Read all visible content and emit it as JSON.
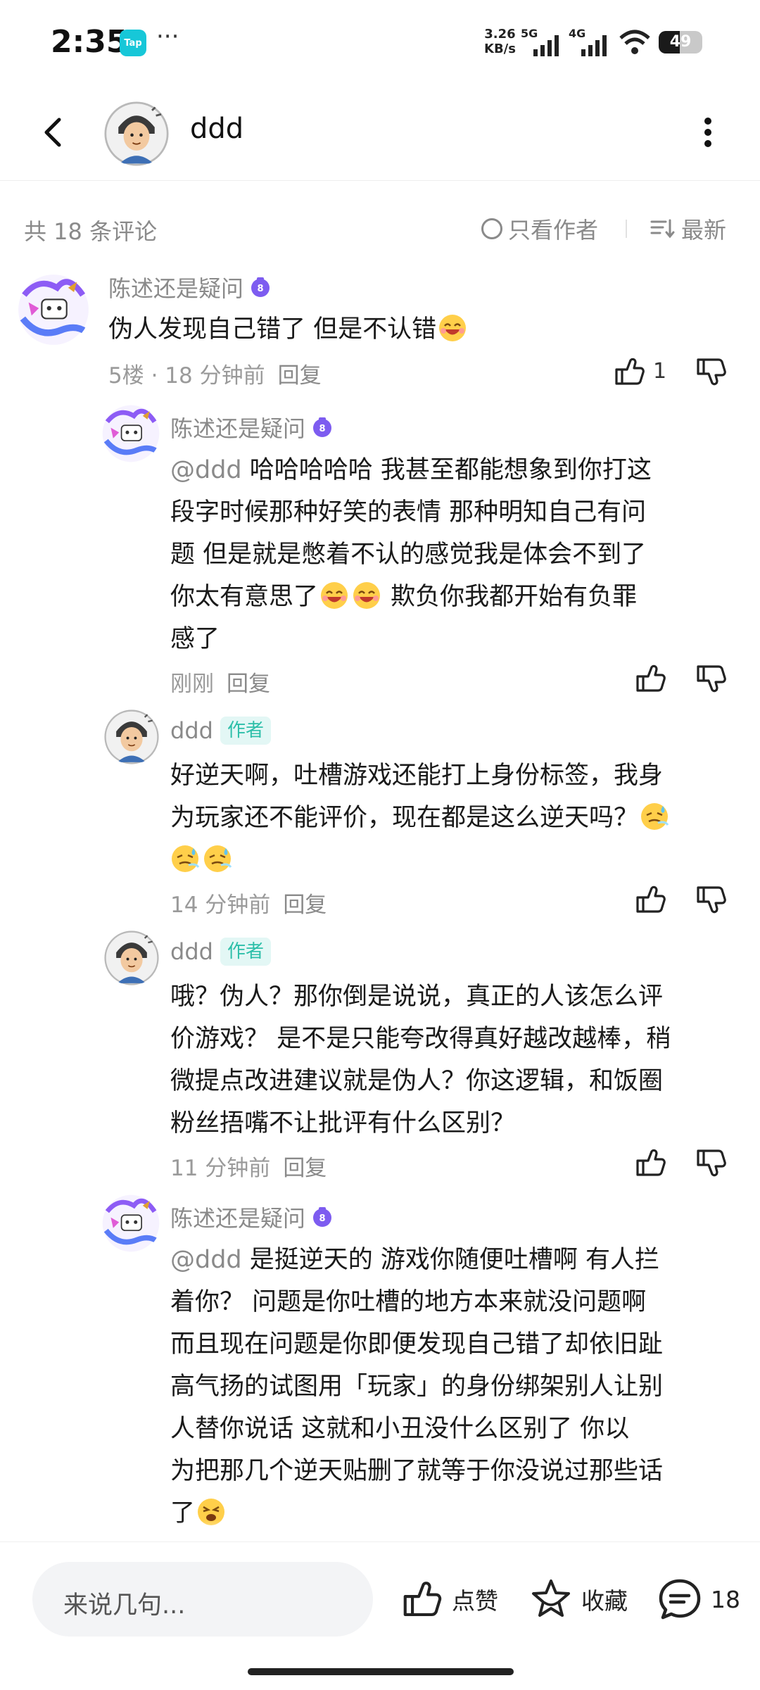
{
  "status_bar": {
    "time": "2:35",
    "app_badge": "Tap",
    "more_dots": "···",
    "speed_value": "3.26",
    "speed_unit": "KB/s",
    "net1": "5G",
    "net2": "4G",
    "battery": "49",
    "battery_fraction": 0.49
  },
  "header": {
    "title": "ddd",
    "back_icon": "chevron-left-icon",
    "more_icon": "vertical-dots-icon"
  },
  "filter": {
    "count": "共 18 条评论",
    "only_author": "只看作者",
    "sort": "最新"
  },
  "colors": {
    "author_tag_bg": "#e3f7f5",
    "author_tag_fg": "#2dbfa9",
    "meta_gray": "#9a9a9a",
    "tap_cyan": "#17c7d8"
  },
  "comments": [
    {
      "name": "陈述还是疑问",
      "lines": [
        "伪人发现自己错了  但是不认错"
      ],
      "floor": "5楼",
      "time": "18 分钟前",
      "reply": "回复",
      "likes": "1"
    },
    {
      "name": "陈述还是疑问",
      "mention": "@ddd",
      "lines": [
        "哈哈哈哈哈  我甚至都能想象到你打这",
        "段字时候那种好笑的表情  那种明知自己有问",
        "题  但是就是憋着不认的感觉我是体会不到了",
        "  你太有意思了",
        "欺负你我都开始有负罪",
        "感了"
      ],
      "time": "刚刚",
      "reply": "回复"
    },
    {
      "name": "ddd",
      "tag": "作者",
      "lines": [
        "好逆天啊，吐槽游戏还能打上身份标签，我身",
        "为玩家还不能评价，现在都是这么逆天吗？"
      ],
      "time": "14 分钟前",
      "reply": "回复"
    },
    {
      "name": "ddd",
      "tag": "作者",
      "lines": [
        "哦？伪人？那你倒是说说，真正的人该怎么评",
        "价游戏？ 是不是只能夸改得真好越改越棒，稍",
        "微提点改进建议就是伪人？你这逻辑，和饭圈",
        "粉丝捂嘴不让批评有什么区别？"
      ],
      "time": "11 分钟前",
      "reply": "回复"
    },
    {
      "name": "陈述还是疑问",
      "mention": "@ddd",
      "lines": [
        "是挺逆天的  游戏你随便吐槽啊  有人拦",
        "着你？    问题是你吐槽的地方本来就没问题啊",
        "而且现在问题是你即便发现自己错了却依旧趾",
        "高气扬的试图用「玩家」的身份绑架别人让别",
        "人替你说话    这就和小丑没什么区别了    你以",
        "为把那几个逆天贴删了就等于你没说过那些话",
        "了"
      ]
    }
  ],
  "bottom_bar": {
    "input_placeholder": "来说几句...",
    "like": "点赞",
    "favorite": "收藏",
    "comment_count": "18"
  }
}
